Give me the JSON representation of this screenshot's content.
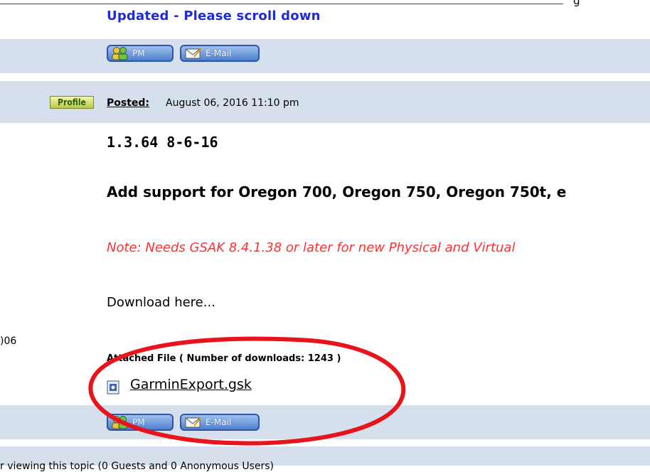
{
  "top": {
    "tail_text": "g",
    "updated_title": "Updated - Please scroll down"
  },
  "buttons": {
    "pm_label": "PM",
    "email_label": "E-Mail"
  },
  "post": {
    "profile_label": "Profile",
    "posted_label": "Posted:",
    "posted_date": "August 06, 2016 11:10 pm",
    "version": "1.3.64 8-6-16",
    "support_line": "Add support for Oregon 700, Oregon 750, Oregon 750t, e",
    "note_line": "Note: Needs GSAK 8.4.1.38 or later for new Physical and Virtual",
    "download_text": "Download here...",
    "attached_label": "Attached File ( Number of downloads: 1243 )",
    "file_name": "GarminExport.gsk"
  },
  "left_column": {
    "join_fragment": ")06"
  },
  "bottom": {
    "fragment": "r  viewing this topic (0 Guests and 0 Anonymous Users)"
  },
  "colors": {
    "band": "#d6e0ec",
    "link_blue": "#1e2bd6",
    "note_red": "#ff3030",
    "annotation_red": "#e8141c"
  }
}
